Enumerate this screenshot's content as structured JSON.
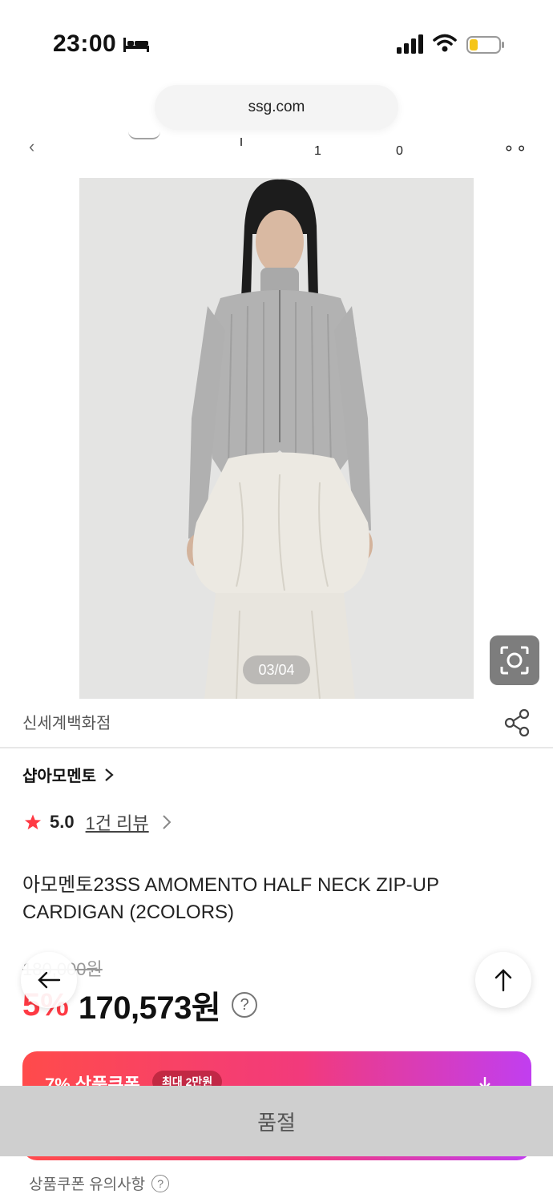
{
  "status_bar": {
    "time": "23:00",
    "icons": [
      "bed-icon",
      "signal-icon",
      "wifi-icon",
      "battery-icon"
    ],
    "battery_color": "#f5c518"
  },
  "browser": {
    "url": "ssg.com"
  },
  "header": {
    "cart_count": "1",
    "second_count": "0",
    "more_label": "∘∘"
  },
  "gallery": {
    "counter": "03/04",
    "lens_icon": "image-search-icon"
  },
  "store": {
    "name": "신세계백화점",
    "share_icon": "share-icon"
  },
  "brand": {
    "label": "샵아모멘토"
  },
  "rating": {
    "score": "5.0",
    "review_link": "1건 리뷰",
    "star_color": "#ff3a44"
  },
  "product": {
    "title": "아모멘토23SS AMOMENTO HALF NECK ZIP-UP CARDIGAN (2COLORS)",
    "original_price": "180,000원",
    "discount_rate": "5%",
    "sale_price": "170,573원",
    "help": "?"
  },
  "coupon": {
    "title": "7% 상품쿠폰",
    "badge": "최대 2만원",
    "gradient_start": "#ff4b4b",
    "gradient_end": "#c13ef0"
  },
  "purchase": {
    "soldout_label": "품절"
  },
  "notice": {
    "label": "상품쿠폰 유의사항",
    "help": "?"
  },
  "colors": {
    "accent": "#ff3a44",
    "soldout_bg": "#cfcfcf"
  }
}
